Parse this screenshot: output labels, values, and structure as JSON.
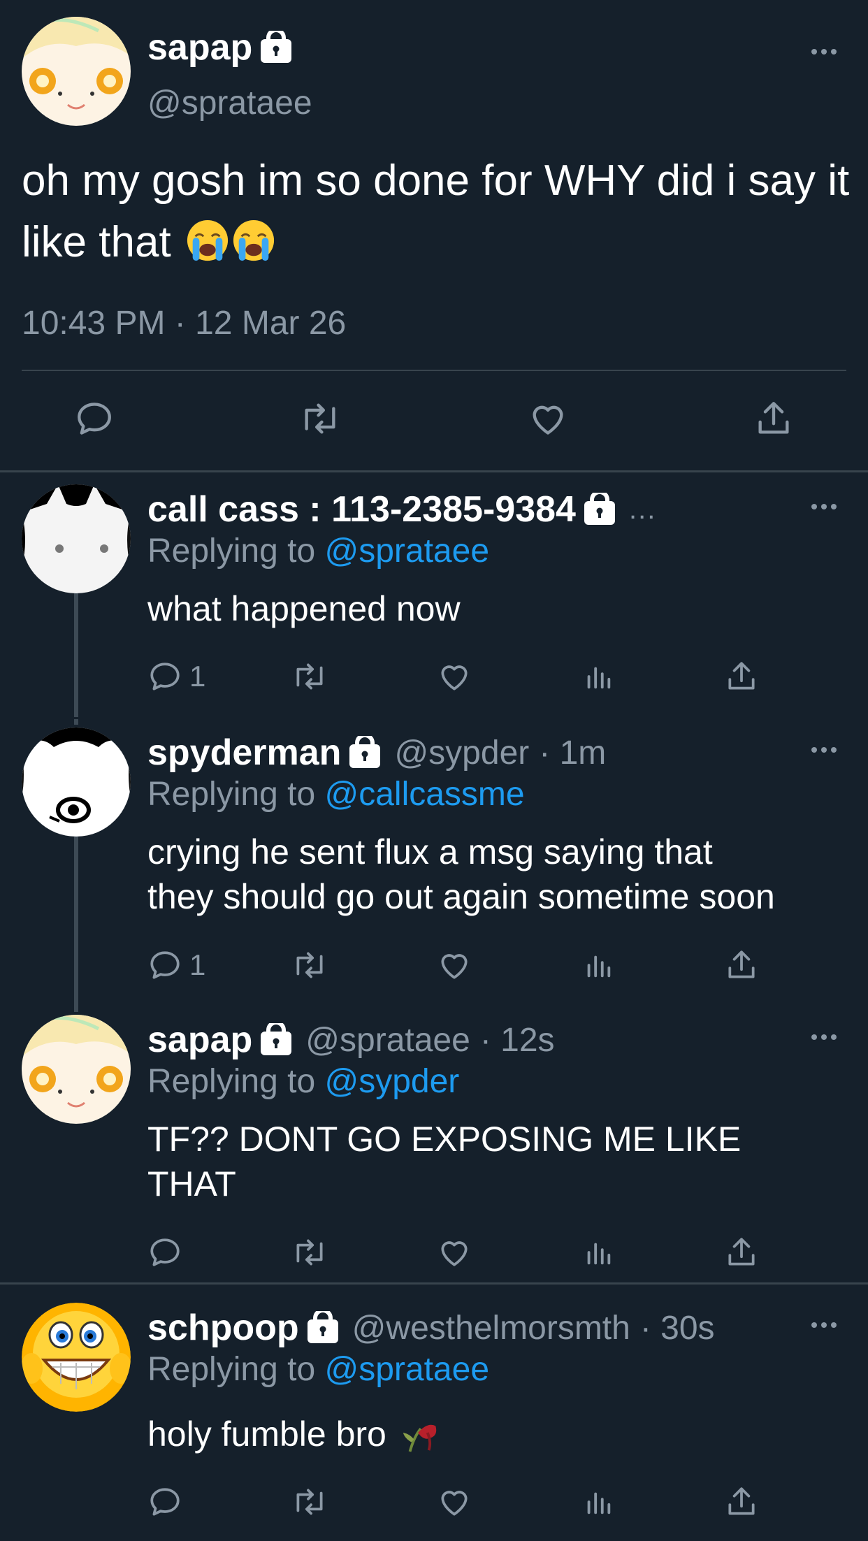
{
  "main_tweet": {
    "display_name": "sapap",
    "handle": "@sprataee",
    "text": "oh my gosh im so done for WHY did i say it like that",
    "emojis": [
      "loudly-crying-face",
      "loudly-crying-face"
    ],
    "timestamp": "10:43 PM · 12 Mar 26",
    "actions": [
      "reply-icon",
      "retweet-icon",
      "like-icon",
      "share-icon"
    ]
  },
  "replies": [
    {
      "display_name": "call cass : 113-2385-9384",
      "truncation": "...",
      "handle": "",
      "time": "",
      "replying_prefix": "Replying to",
      "replying_to": "@sprataee",
      "text": "what happened now",
      "reply_count": "1"
    },
    {
      "display_name": "spyderman",
      "handle": "@sypder",
      "time": "· 1m",
      "replying_prefix": "Replying to",
      "replying_to": "@callcassme",
      "text_lines": [
        "crying he sent flux a msg saying that",
        "they should go out again sometime soon"
      ],
      "reply_count": "1"
    },
    {
      "display_name": "sapap",
      "handle": "@sprataee",
      "time": "· 12s",
      "replying_prefix": "Replying to",
      "replying_to": "@sypder",
      "text_lines": [
        "TF?? DONT GO EXPOSING ME LIKE",
        "THAT"
      ],
      "reply_count": ""
    },
    {
      "display_name": "schpoop",
      "handle": "@westhelmorsmth",
      "time": "· 30s",
      "replying_prefix": "Replying to",
      "replying_to": "@sprataee",
      "text": "holy fumble bro",
      "emoji": "wilted-flower",
      "reply_count": ""
    }
  ],
  "colors": {
    "background": "#15202b",
    "divider": "#38444d",
    "secondary_text": "#8b98a5",
    "link": "#1d9bf0",
    "thread_line": "#3d4a55"
  }
}
